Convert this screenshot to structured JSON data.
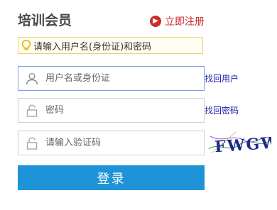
{
  "title": "培训会员",
  "register": {
    "label": "立即注册",
    "icon": "arrow-right-circle-icon",
    "color": "#cc2b2b"
  },
  "hint": {
    "icon": "lightbulb-icon",
    "text": "请输入用户名(身份证)和密码"
  },
  "form": {
    "username": {
      "placeholder": "用户名或身份证",
      "value": "",
      "icon": "user-icon"
    },
    "password": {
      "placeholder": "密码",
      "value": "",
      "icon": "lock-icon"
    },
    "captcha": {
      "placeholder": "请输入验证码",
      "value": "",
      "icon": "lock-icon",
      "image_text": "FWGW"
    }
  },
  "links": {
    "find_user": "找回用户",
    "find_password": "找回密码"
  },
  "login_button": "登录",
  "colors": {
    "primary": "#1e93d8",
    "accent": "#cc2b2b",
    "link": "#1a1aa6",
    "focus_border": "#7aa0de"
  }
}
